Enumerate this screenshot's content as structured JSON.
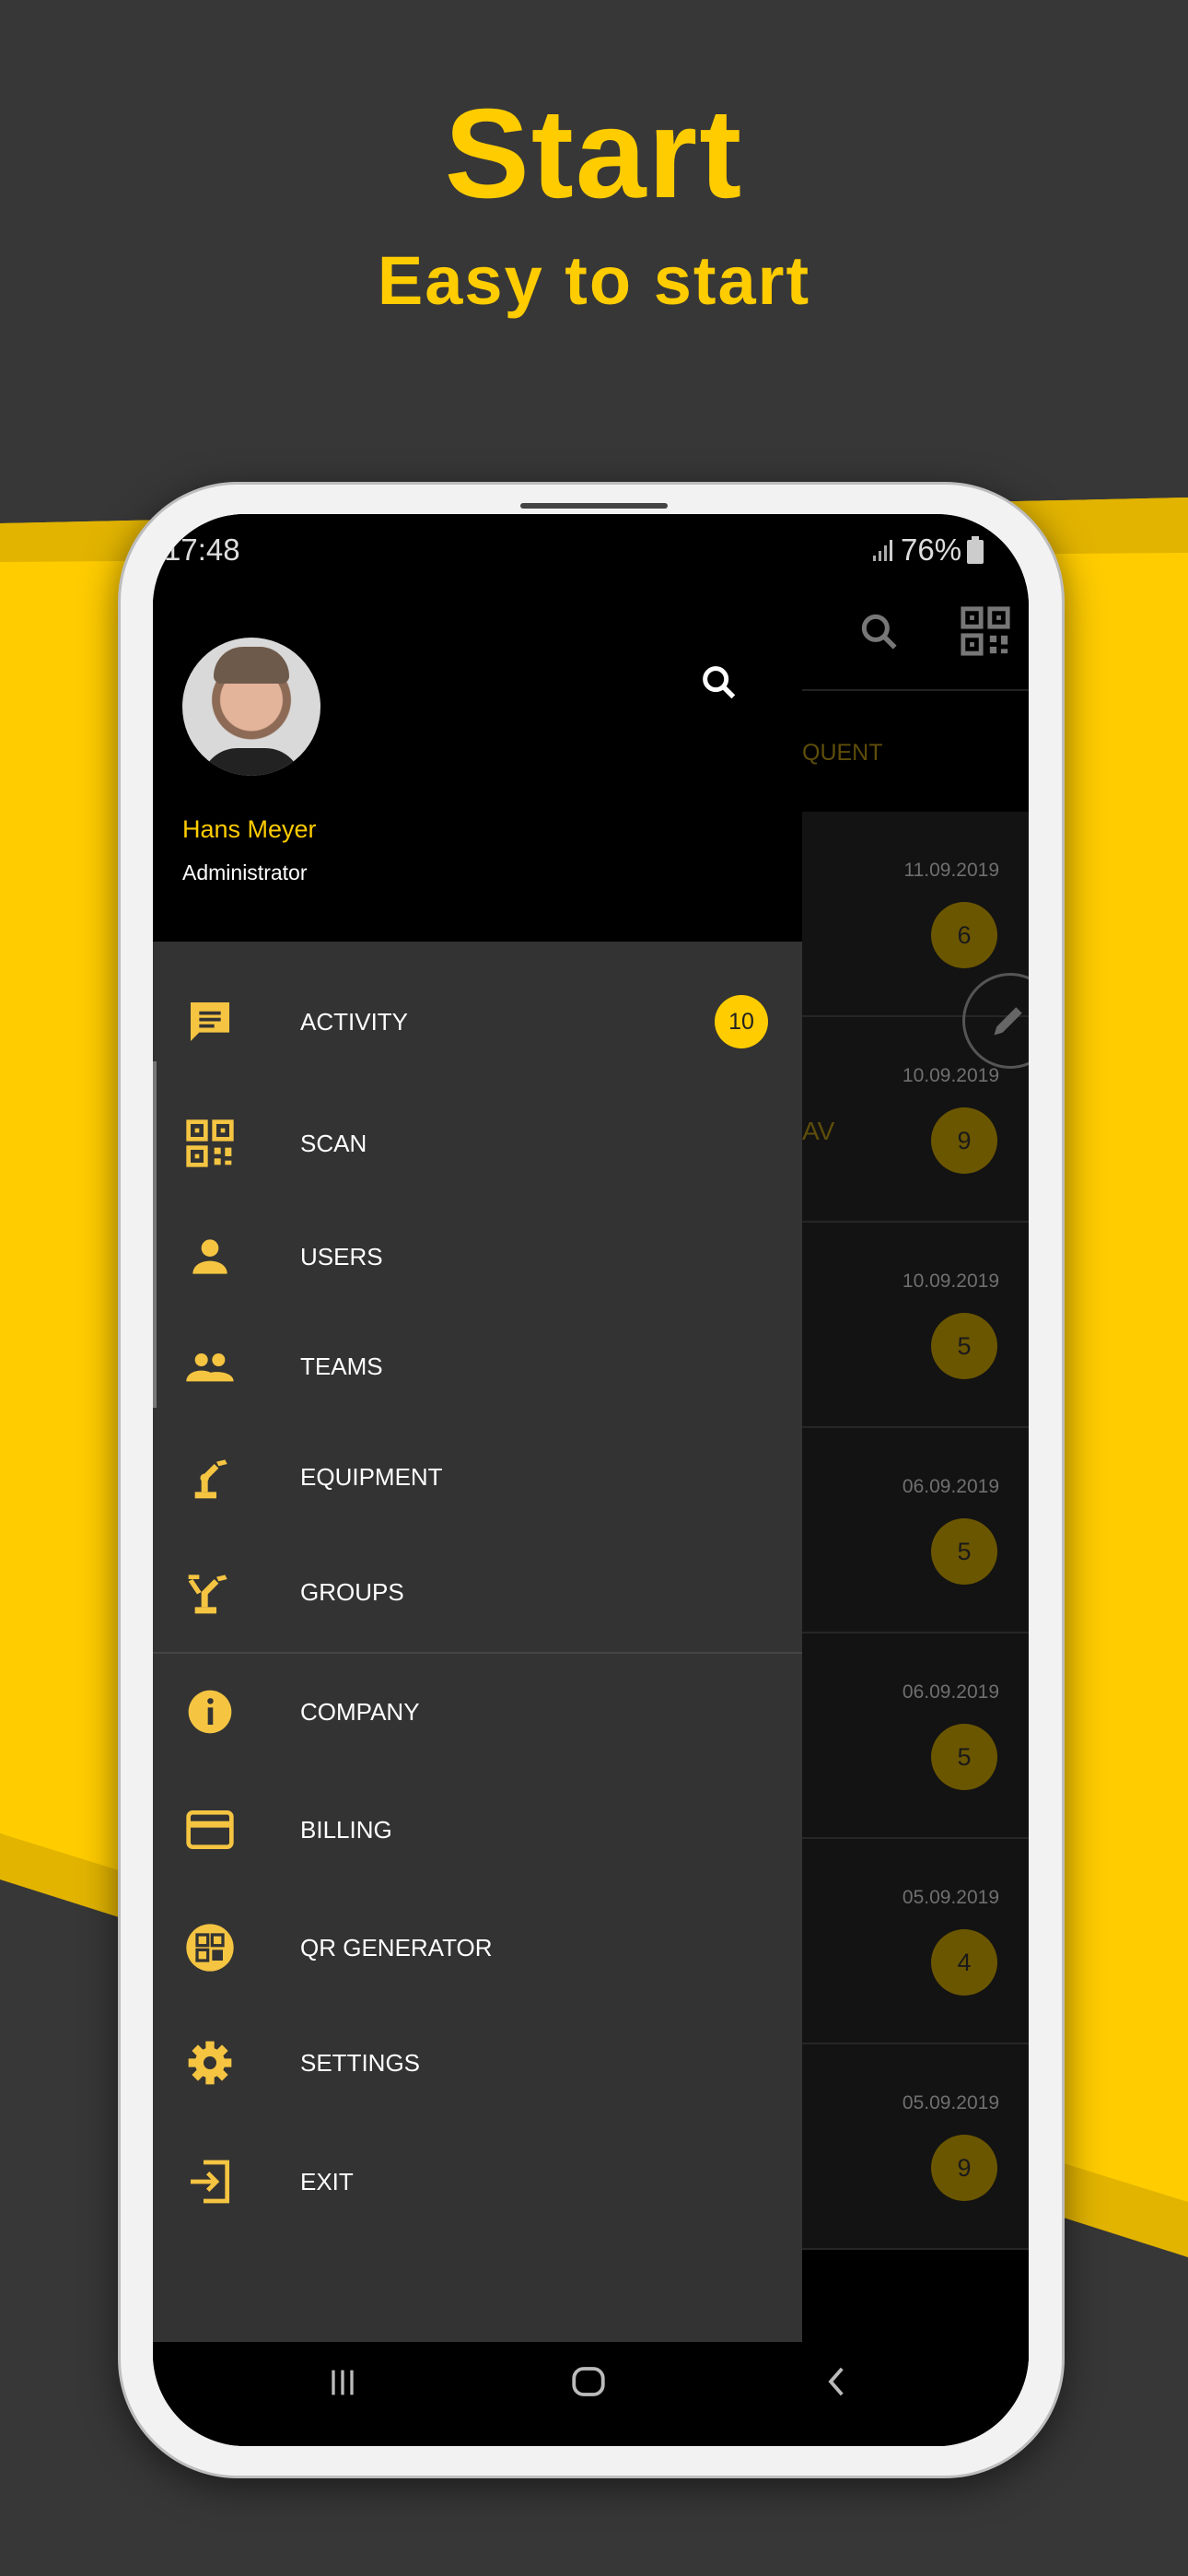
{
  "promo": {
    "title": "Start",
    "subtitle": "Easy to start"
  },
  "colors": {
    "accent": "#ffcc00",
    "background": "#373737",
    "drawer": "#333333"
  },
  "status_bar": {
    "time": "17:48",
    "battery": "76%"
  },
  "drawer": {
    "user": {
      "name": "Hans Meyer",
      "role": "Administrator"
    },
    "items": [
      {
        "label": "ACTIVITY",
        "icon": "chat-icon",
        "badge": "10"
      },
      {
        "label": "SCAN",
        "icon": "qr-code-icon"
      },
      {
        "label": "USERS",
        "icon": "person-icon"
      },
      {
        "label": "TEAMS",
        "icon": "people-icon"
      },
      {
        "label": "EQUIPMENT",
        "icon": "robot-arm-icon"
      },
      {
        "label": "GROUPS",
        "icon": "robot-arms-icon"
      },
      {
        "label": "COMPANY",
        "icon": "info-icon"
      },
      {
        "label": "BILLING",
        "icon": "credit-card-icon"
      },
      {
        "label": "QR GENERATOR",
        "icon": "qr-circle-icon"
      },
      {
        "label": "SETTINGS",
        "icon": "gear-icon"
      },
      {
        "label": "EXIT",
        "icon": "exit-icon"
      }
    ]
  },
  "background_screen": {
    "tab_partial": "QUENT",
    "row_partial": "AV",
    "rows": [
      {
        "date": "11.09.2019",
        "count": "6"
      },
      {
        "date": "10.09.2019",
        "count": "9"
      },
      {
        "date": "10.09.2019",
        "count": "5"
      },
      {
        "date": "06.09.2019",
        "count": "5"
      },
      {
        "date": "06.09.2019",
        "count": "5"
      },
      {
        "date": "05.09.2019",
        "count": "4"
      },
      {
        "date": "05.09.2019",
        "count": "9"
      }
    ]
  }
}
